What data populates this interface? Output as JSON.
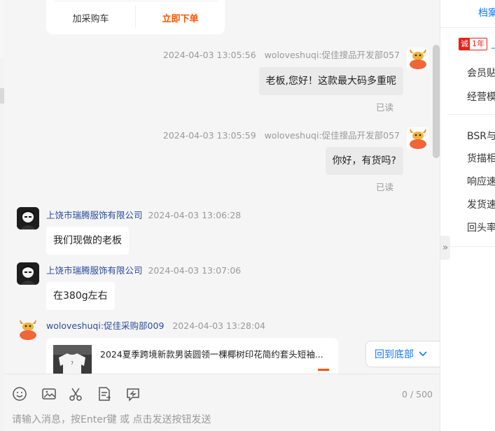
{
  "product_card_top": {
    "add_cart_label": "加采购车",
    "buy_now_label": "立即下单"
  },
  "messages": [
    {
      "side": "right",
      "sender": "woloveshuqi:促佳搜品开发部057",
      "time": "2024-04-03 13:05:56",
      "text": "老板,您好！这款最大码多重呢",
      "status": "已读"
    },
    {
      "side": "right",
      "sender": "woloveshuqi:促佳搜品开发部057",
      "time": "2024-04-03 13:05:59",
      "text": "你好，有货吗?",
      "status": "已读"
    },
    {
      "side": "left",
      "sender": "上饶市瑞腾服饰有限公司",
      "time": "2024-04-03 13:06:28",
      "text": "我们现做的老板"
    },
    {
      "side": "left",
      "sender": "上饶市瑞腾服饰有限公司",
      "time": "2024-04-03 13:07:06",
      "text": "在380g左右"
    },
    {
      "side": "left",
      "sender": "woloveshuqi:促佳采购部009",
      "time": "2024-04-03 13:28:04"
    }
  ],
  "product_card": {
    "title": "2024夏季跨境新款男装圆领一棵椰树印花简约套头短袖..."
  },
  "back_to_bottom": "回到底部",
  "input": {
    "counter": "0 / 500",
    "placeholder": "请输入消息，按Enter键 或 点击发送按钮发送"
  },
  "right_panel": {
    "tab": "档案",
    "badge_cheng": "诚",
    "badge_year": "1年",
    "badge_trailing": "上",
    "items_group1": [
      "会员贴",
      "经营模"
    ],
    "items_group2": [
      "BSR与",
      "货描相",
      "响应速",
      "发货速",
      "回头率"
    ]
  },
  "colors": {
    "accent_blue": "#1677ff",
    "buy_orange": "#ff5500",
    "name_blue": "#2b4c9c",
    "chat_bg": "#f5f5f5"
  }
}
